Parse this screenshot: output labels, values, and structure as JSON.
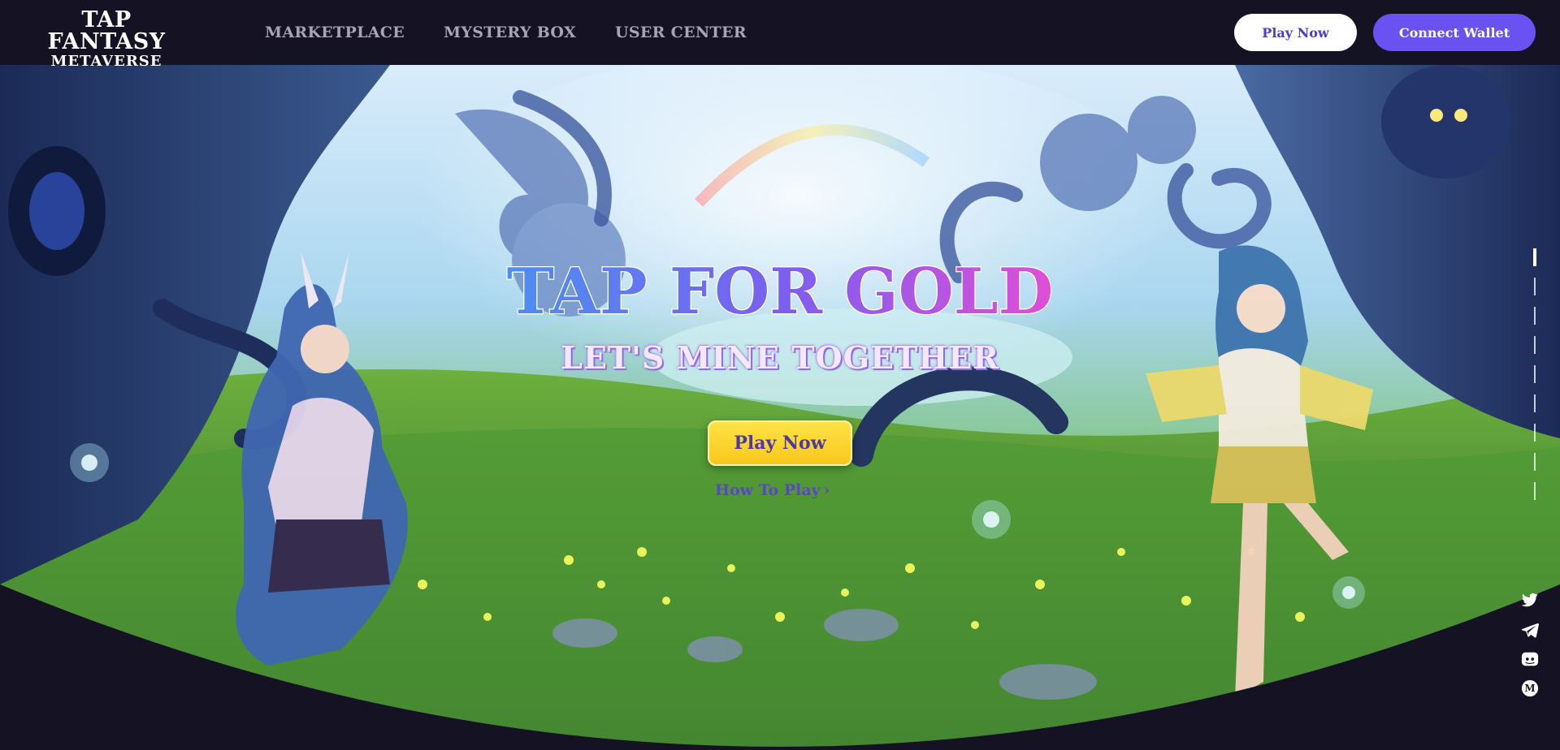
{
  "header": {
    "logo_line1": "TAP FANTASY",
    "logo_line2": "METAVERSE",
    "nav": [
      {
        "label": "MARKETPLACE"
      },
      {
        "label": "MYSTERY BOX"
      },
      {
        "label": "USER CENTER"
      }
    ],
    "play_now_label": "Play Now",
    "connect_wallet_label": "Connect Wallet"
  },
  "hero": {
    "title": "TAP FOR GOLD",
    "subtitle": "LET'S MINE TOGETHER",
    "play_now_label": "Play Now",
    "how_to_play_label": "How To Play",
    "how_to_play_arrow": "›"
  },
  "side_indicator": {
    "active_index": 0
  },
  "socials": [
    {
      "icon": "twitter-icon"
    },
    {
      "icon": "telegram-icon"
    },
    {
      "icon": "discord-icon"
    },
    {
      "icon": "medium-icon"
    }
  ],
  "colors": {
    "header_bg": "#151224",
    "accent_purple": "#6a51f2",
    "button_yellow": "#f8c81b",
    "nav_text": "#a7a4b3",
    "title_gradient_start": "#4c8ff2",
    "title_gradient_end": "#e04ed6"
  }
}
